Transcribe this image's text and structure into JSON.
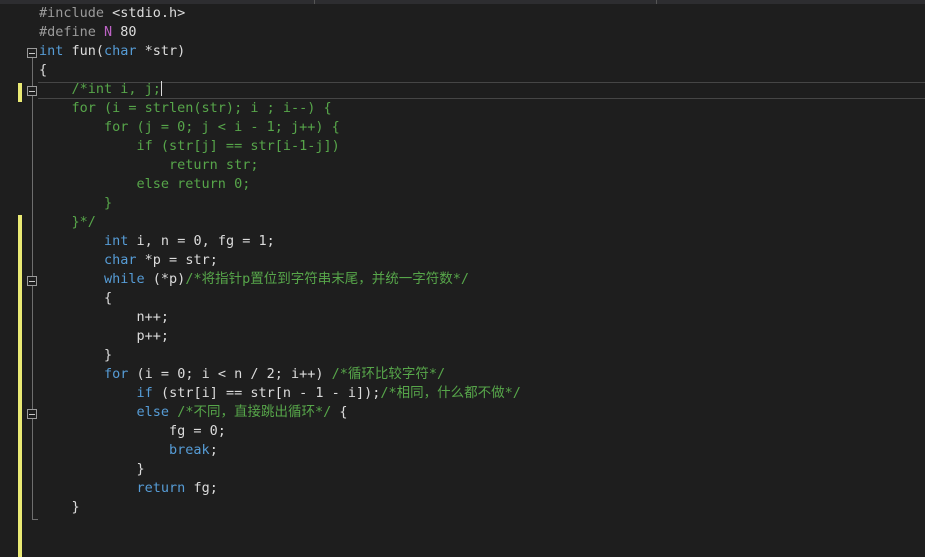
{
  "editor": {
    "lines": [
      [
        {
          "c": "pp",
          "t": "#include "
        },
        {
          "c": "txt",
          "t": "<stdio.h>"
        }
      ],
      [
        {
          "c": "pp",
          "t": "#define "
        },
        {
          "c": "mac",
          "t": "N"
        },
        {
          "c": "txt",
          "t": " 80"
        }
      ],
      [
        {
          "c": "kw",
          "t": "int"
        },
        {
          "c": "txt",
          "t": " fun("
        },
        {
          "c": "kw",
          "t": "char"
        },
        {
          "c": "txt",
          "t": " *str)"
        }
      ],
      [
        {
          "c": "txt",
          "t": "{"
        }
      ],
      [
        {
          "c": "cm",
          "t": "    /*int i, j;"
        }
      ],
      [
        {
          "c": "cm",
          "t": "    for (i = strlen(str); i ; i--) {"
        }
      ],
      [
        {
          "c": "cm",
          "t": "        for (j = 0; j < i - 1; j++) {"
        }
      ],
      [
        {
          "c": "cm",
          "t": "            if (str[j] == str[i-1-j])"
        }
      ],
      [
        {
          "c": "cm",
          "t": "                return str;"
        }
      ],
      [
        {
          "c": "cm",
          "t": "            else return 0;"
        }
      ],
      [
        {
          "c": "cm",
          "t": "        }"
        }
      ],
      [
        {
          "c": "cm",
          "t": "    }*/"
        }
      ],
      [
        {
          "c": "txt",
          "t": "        "
        },
        {
          "c": "kw",
          "t": "int"
        },
        {
          "c": "txt",
          "t": " i, n = 0, fg = 1;"
        }
      ],
      [
        {
          "c": "txt",
          "t": "        "
        },
        {
          "c": "kw",
          "t": "char"
        },
        {
          "c": "txt",
          "t": " *p = str;"
        }
      ],
      [
        {
          "c": "txt",
          "t": "        "
        },
        {
          "c": "kw",
          "t": "while"
        },
        {
          "c": "txt",
          "t": " (*p)"
        },
        {
          "c": "cm",
          "t": "/*将指针p置位到字符串末尾，并统一字符数*/"
        }
      ],
      [
        {
          "c": "txt",
          "t": "        {"
        }
      ],
      [
        {
          "c": "txt",
          "t": "            n++;"
        }
      ],
      [
        {
          "c": "txt",
          "t": "            p++;"
        }
      ],
      [
        {
          "c": "txt",
          "t": "        }"
        }
      ],
      [
        {
          "c": "txt",
          "t": "        "
        },
        {
          "c": "kw",
          "t": "for"
        },
        {
          "c": "txt",
          "t": " (i = 0; i < n / 2; i++) "
        },
        {
          "c": "cm",
          "t": "/*循环比较字符*/"
        }
      ],
      [
        {
          "c": "txt",
          "t": "            "
        },
        {
          "c": "kw",
          "t": "if"
        },
        {
          "c": "txt",
          "t": " (str[i] == str[n - 1 - i]);"
        },
        {
          "c": "cm",
          "t": "/*相同，什么都不做*/"
        }
      ],
      [
        {
          "c": "txt",
          "t": "            "
        },
        {
          "c": "kw",
          "t": "else"
        },
        {
          "c": "txt",
          "t": " "
        },
        {
          "c": "cm",
          "t": "/*不同，直接跳出循环*/"
        },
        {
          "c": "txt",
          "t": " {"
        }
      ],
      [
        {
          "c": "txt",
          "t": "                fg = 0;"
        }
      ],
      [
        {
          "c": "txt",
          "t": "                "
        },
        {
          "c": "kw",
          "t": "break"
        },
        {
          "c": "txt",
          "t": ";"
        }
      ],
      [
        {
          "c": "txt",
          "t": "            }"
        }
      ],
      [
        {
          "c": "txt",
          "t": "            "
        },
        {
          "c": "kw",
          "t": "return"
        },
        {
          "c": "txt",
          "t": " fg;"
        }
      ],
      [
        {
          "c": "txt",
          "t": "    }"
        }
      ]
    ]
  }
}
